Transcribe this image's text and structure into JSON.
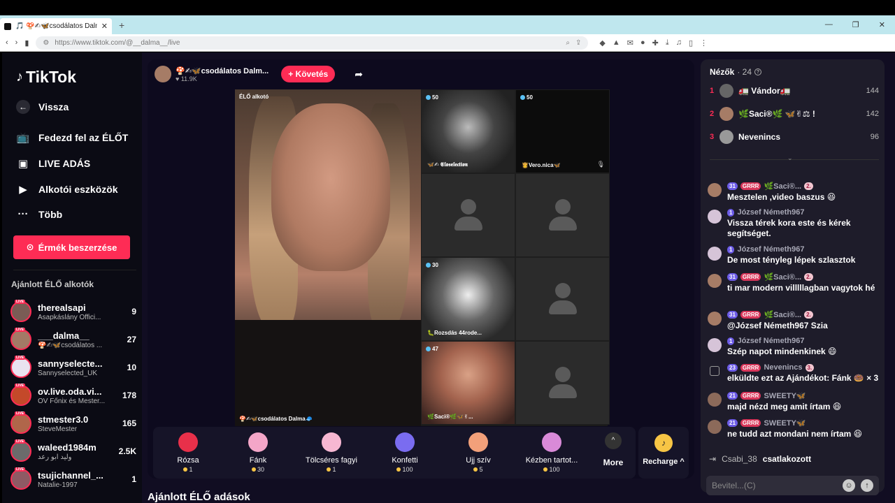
{
  "browser": {
    "tab_title": "🎵 🍄✍🦋csodálatos Dalma🧢",
    "url": "https://www.tiktok.com/@__dalma__/live"
  },
  "sidebar": {
    "logo": "TikTok",
    "back": "Vissza",
    "nav": [
      "Fedezd fel az ÉLŐT",
      "LIVE ADÁS",
      "Alkotói eszközök",
      "Több"
    ],
    "coins_button": "Érmék beszerzése",
    "recommended_title": "Ajánlott ÉLŐ alkotók",
    "creators": [
      {
        "name": "therealsapi",
        "sub": "Asapkáslány Offici...",
        "count": "9"
      },
      {
        "name": "___dalma__",
        "sub": "🍄✍🦋csodálatos ...",
        "count": "27"
      },
      {
        "name": "sannyselecte...",
        "sub": "Sannyselected_UK",
        "count": "10"
      },
      {
        "name": "ov.live.oda.vi...",
        "sub": "OV Főnix és Mester...",
        "count": "178"
      },
      {
        "name": "stmester3.0",
        "sub": "SteveMester",
        "count": "165"
      },
      {
        "name": "waleed1984m",
        "sub": "وليد ابو رعد",
        "count": "2.5K"
      },
      {
        "name": "tsujichannel_...",
        "sub": "Natalie-1997",
        "count": "1"
      }
    ]
  },
  "stream": {
    "host_name": "🍄✍🦋csodálatos Dalm...",
    "likes": "♥ 11.9K",
    "follow_label": "+ Követés",
    "big_label": "ÉLŐ alkotó",
    "big_name": "🍄✍🦋csodálatos Dalma🧢",
    "tiles": [
      {
        "badge": "50",
        "label": "🦋✍ 𝕰𝖑𝖔𝖘𝖊𝖑𝖊𝖈𝖙𝖎𝖔𝖓",
        "mic": ""
      },
      {
        "badge": "50",
        "label": "👸Vero.nica🦋",
        "mic": "🎙"
      },
      {
        "badge": "",
        "label": "",
        "mic": ""
      },
      {
        "badge": "",
        "label": "",
        "mic": ""
      },
      {
        "badge": "30",
        "label": "🐛Rozsdás 44rode...",
        "mic": ""
      },
      {
        "badge": "",
        "label": "",
        "mic": ""
      },
      {
        "badge": "47",
        "label": "🌿Saci®🌿🦋✌...",
        "mic": ""
      },
      {
        "badge": "",
        "label": "",
        "mic": ""
      }
    ]
  },
  "gifts": [
    {
      "name": "Rózsa",
      "price": "1",
      "color": "#e8304a"
    },
    {
      "name": "Fánk",
      "price": "30",
      "color": "#f4a6c8"
    },
    {
      "name": "Tölcséres fagyi",
      "price": "1",
      "color": "#f7b7d2"
    },
    {
      "name": "Konfetti",
      "price": "100",
      "color": "#7a6cf0"
    },
    {
      "name": "Ujj szív",
      "price": "5",
      "color": "#f2a07a"
    },
    {
      "name": "Kézben tartot...",
      "price": "100",
      "color": "#d98ad8"
    }
  ],
  "more_label": "More",
  "recharge_label": "Recharge ^",
  "section_title": "Ajánlott ÉLŐ adások",
  "chat": {
    "title": "Nézők",
    "count": "· 24",
    "viewers": [
      {
        "rank": "1",
        "name": "🚛 Vándor🚛",
        "score": "144"
      },
      {
        "rank": "2",
        "name": "🌿Saci®🌿 🦋✌⚖ !",
        "score": "142"
      },
      {
        "rank": "3",
        "name": "Nevenincs",
        "score": "96"
      }
    ],
    "messages": [
      {
        "lvl": "31",
        "team": "GRRR",
        "user": "🌿Saci®...",
        "fan": "2.",
        "text": "Mesztelen ,video baszus 😆"
      },
      {
        "lvl": "1",
        "team": "",
        "user": "József Németh967",
        "fan": "",
        "text": "Vissza térek kora este és kérek segítséget."
      },
      {
        "lvl": "1",
        "team": "",
        "user": "József Németh967",
        "fan": "",
        "text": "De most tényleg lépek szlasztok"
      },
      {
        "lvl": "31",
        "team": "GRRR",
        "user": "🌿Saci®...",
        "fan": "2.",
        "text": "ti mar modern villlllagban vagytok hé"
      },
      {
        "lvl": "31",
        "team": "GRRR",
        "user": "🌿Saci®...",
        "fan": "2.",
        "text": "@József Németh967 Szia"
      },
      {
        "lvl": "1",
        "team": "",
        "user": "József Németh967",
        "fan": "",
        "text": "Szép napot mindenkinek 😄"
      },
      {
        "lvl": "23",
        "team": "GRRR",
        "user": "Nevenincs",
        "fan": "3.",
        "text": "elküldte ezt az Ajándékot: Fánk 🍩 × 3"
      },
      {
        "lvl": "21",
        "team": "GRRR",
        "user": "SWEETY🦋",
        "fan": "",
        "text": "majd nézd meg amit írtam 😆"
      },
      {
        "lvl": "21",
        "team": "GRRR",
        "user": "SWEETY🦋",
        "fan": "",
        "text": "ne tudd azt mondani nem írtam 😆"
      }
    ],
    "joined_user": "Csabi_38",
    "joined_text": "csatlakozott",
    "input_placeholder": "Bevitel...(C)"
  }
}
